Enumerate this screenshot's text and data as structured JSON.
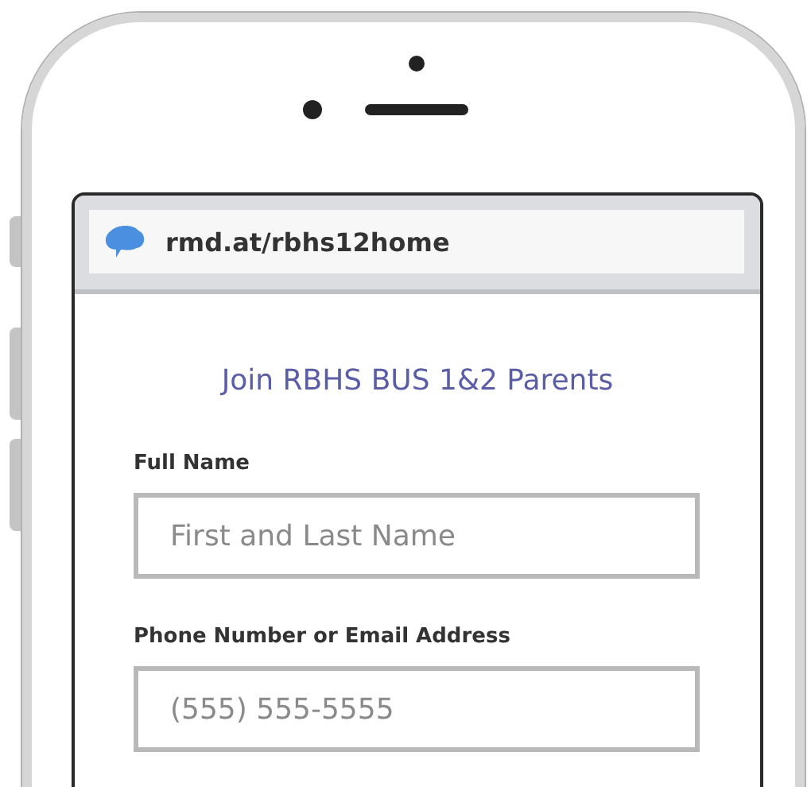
{
  "address_bar": {
    "url": "rmd.at/rbhs12home"
  },
  "form": {
    "title": "Join RBHS BUS 1&2 Parents",
    "fields": [
      {
        "label": "Full Name",
        "placeholder": "First and Last Name"
      },
      {
        "label": "Phone Number or Email Address",
        "placeholder": "(555) 555-5555"
      }
    ]
  }
}
